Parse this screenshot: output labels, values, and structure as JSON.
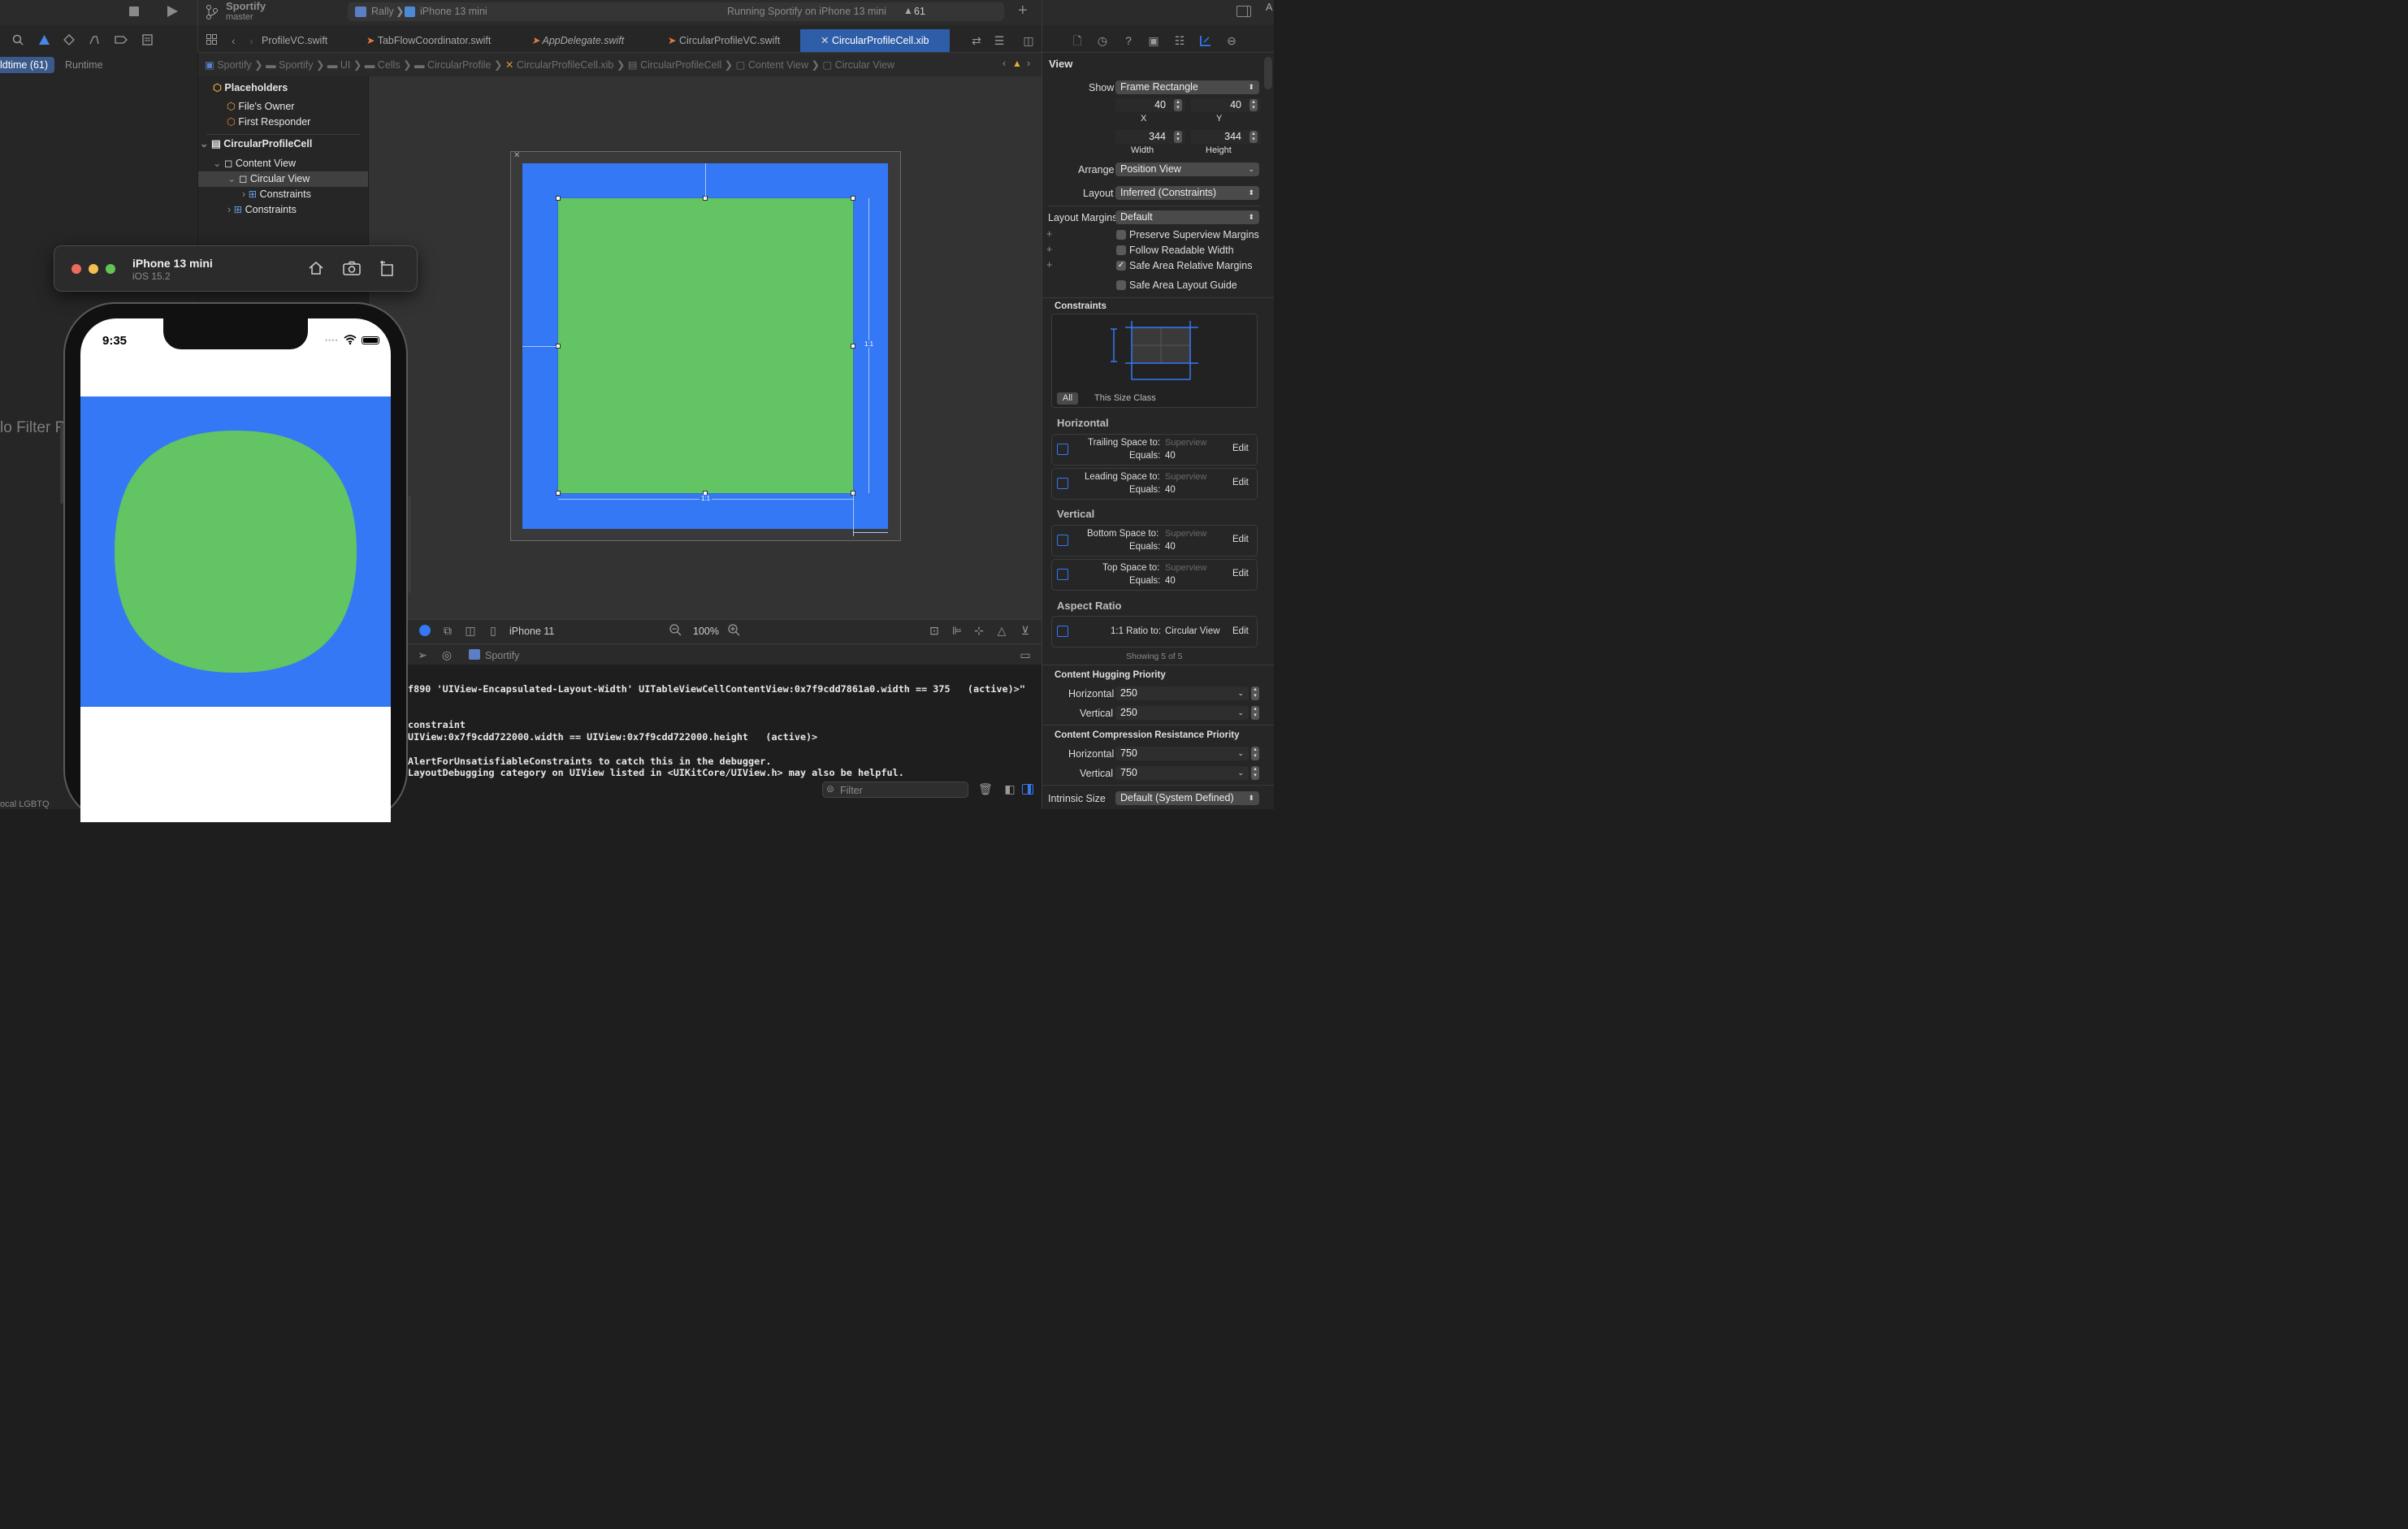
{
  "toolbar": {
    "project": "Sportify",
    "branch": "master",
    "scheme": "Rally",
    "device": "iPhone 13 mini",
    "status": "Running Sportify on iPhone 13 mini",
    "warnings_count": "61"
  },
  "navigator": {
    "filter_buildtime": "ldtime (61)",
    "filter_runtime": "Runtime",
    "no_filter_text": "lo Filter R",
    "bottom_cut": "ocal LGBTQ"
  },
  "tabs": [
    "ProfileVC.swift",
    "TabFlowCoordinator.swift",
    "AppDelegate.swift",
    "CircularProfileVC.swift",
    "CircularProfileCell.xib"
  ],
  "breadcrumb": [
    "Sportify",
    "Sportify",
    "UI",
    "Cells",
    "CircularProfile",
    "CircularProfileCell.xib",
    "CircularProfileCell",
    "Content View",
    "Circular View"
  ],
  "outline": {
    "placeholders": "Placeholders",
    "files_owner": "File's Owner",
    "first_responder": "First Responder",
    "cell": "CircularProfileCell",
    "content_view": "Content View",
    "circular_view": "Circular View",
    "constraints_inner": "Constraints",
    "constraints_outer": "Constraints"
  },
  "simulator": {
    "title": "iPhone 13 mini",
    "os": "iOS 15.2",
    "time": "9:35"
  },
  "canvas": {
    "ratio_badge": "1:1",
    "device": "iPhone 11",
    "zoom": "100%"
  },
  "debug": {
    "target": "Sportify",
    "lines": [
      "f890 'UIView-Encapsulated-Layout-Width' UITableViewCellContentView:0x7f9cdd7861a0.width == 375   (active)>\"",
      "",
      "constraint",
      "UIView:0x7f9cdd722000.width == UIView:0x7f9cdd722000.height   (active)>",
      "",
      "AlertForUnsatisfiableConstraints to catch this in the debugger.",
      "LayoutDebugging category on UIView listed in <UIKitCore/UIView.h> may also be helpful."
    ],
    "filter_placeholder": "Filter"
  },
  "inspector": {
    "section": "View",
    "show_label": "Show",
    "show_value": "Frame Rectangle",
    "x_value": "40",
    "y_value": "40",
    "x_label": "X",
    "y_label": "Y",
    "width_value": "344",
    "height_value": "344",
    "width_label": "Width",
    "height_label": "Height",
    "arrange_label": "Arrange",
    "arrange_value": "Position View",
    "layout_label": "Layout",
    "layout_value": "Inferred (Constraints)",
    "margins_label": "Layout Margins",
    "margins_value": "Default",
    "checkboxes": [
      {
        "label": "Preserve Superview Margins",
        "checked": false
      },
      {
        "label": "Follow Readable Width",
        "checked": false
      },
      {
        "label": "Safe Area Relative Margins",
        "checked": true
      },
      {
        "label": "Safe Area Layout Guide",
        "checked": false
      }
    ],
    "constraints_header": "Constraints",
    "seg_all": "All",
    "seg_size_class": "This Size Class",
    "horizontal_header": "Horizontal",
    "vertical_header": "Vertical",
    "aspect_header": "Aspect Ratio",
    "constraint_cards": [
      {
        "title": "Trailing Space to:",
        "target": "Superview",
        "equals": "Equals:",
        "value": "40",
        "edit": "Edit"
      },
      {
        "title": "Leading Space to:",
        "target": "Superview",
        "equals": "Equals:",
        "value": "40",
        "edit": "Edit"
      },
      {
        "title": "Bottom Space to:",
        "target": "Superview",
        "equals": "Equals:",
        "value": "40",
        "edit": "Edit"
      },
      {
        "title": "Top Space to:",
        "target": "Superview",
        "equals": "Equals:",
        "value": "40",
        "edit": "Edit"
      },
      {
        "title": "1:1 Ratio to:",
        "target": "Circular View",
        "edit": "Edit"
      }
    ],
    "showing": "Showing 5 of 5",
    "hugging_header": "Content Hugging Priority",
    "hugging_h_label": "Horizontal",
    "hugging_h_value": "250",
    "hugging_v_label": "Vertical",
    "hugging_v_value": "250",
    "compression_header": "Content Compression Resistance Priority",
    "compression_h_label": "Horizontal",
    "compression_h_value": "750",
    "compression_v_label": "Vertical",
    "compression_v_value": "750",
    "intrinsic_label": "Intrinsic Size",
    "intrinsic_value": "Default (System Defined)"
  },
  "colors": {
    "blue": "#3478f6",
    "green": "#62c462",
    "selection": "#2f5ea8"
  }
}
